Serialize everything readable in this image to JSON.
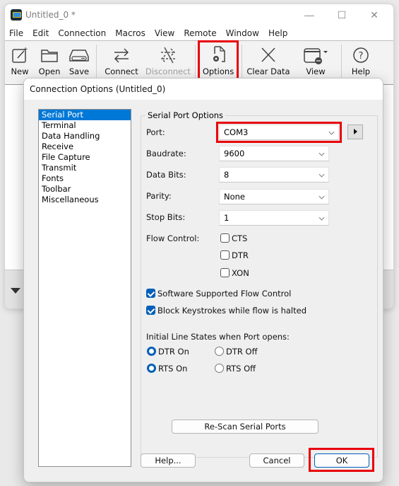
{
  "app": {
    "title": "Untitled_0 *",
    "window_controls": {
      "minimize": "—",
      "maximize": "☐",
      "close": "✕"
    }
  },
  "menu": [
    "File",
    "Edit",
    "Connection",
    "Macros",
    "View",
    "Remote",
    "Window",
    "Help"
  ],
  "toolbar": {
    "new": "New",
    "open": "Open",
    "save": "Save",
    "connect": "Connect",
    "disconnect": "Disconnect",
    "options": "Options",
    "clear_data": "Clear Data",
    "view": "View",
    "help": "Help"
  },
  "dialog": {
    "title": "Connection Options (Untitled_0)",
    "nav": [
      "Serial Port",
      "Terminal",
      "Data Handling",
      "Receive",
      "File Capture",
      "Transmit",
      "Fonts",
      "Toolbar",
      "Miscellaneous"
    ],
    "selected_nav": "Serial Port",
    "group_title": "Serial Port Options",
    "fields": {
      "port": {
        "label": "Port:",
        "value": "COM3"
      },
      "baudrate": {
        "label": "Baudrate:",
        "value": "9600"
      },
      "data_bits": {
        "label": "Data Bits:",
        "value": "8"
      },
      "parity": {
        "label": "Parity:",
        "value": "None"
      },
      "stop_bits": {
        "label": "Stop Bits:",
        "value": "1"
      }
    },
    "flow_control": {
      "label": "Flow Control:",
      "options": [
        {
          "label": "CTS",
          "checked": false
        },
        {
          "label": "DTR",
          "checked": false
        },
        {
          "label": "XON",
          "checked": false
        }
      ]
    },
    "software_flow_control": {
      "label": "Software Supported Flow Control",
      "checked": true
    },
    "block_keystrokes": {
      "label": "Block Keystrokes while flow is halted",
      "checked": true
    },
    "line_states": {
      "label": "Initial Line States when Port opens:",
      "dtr_on": "DTR On",
      "dtr_off": "DTR Off",
      "rts_on": "RTS On",
      "rts_off": "RTS Off",
      "dtr_selected": "DTR On",
      "rts_selected": "RTS On"
    },
    "rescan_button": "Re-Scan Serial Ports",
    "help_button": "Help...",
    "cancel_button": "Cancel",
    "ok_button": "OK"
  },
  "colors": {
    "accent": "#005fb8",
    "selection": "#0078d7",
    "highlight_annotation": "#e8000b"
  }
}
